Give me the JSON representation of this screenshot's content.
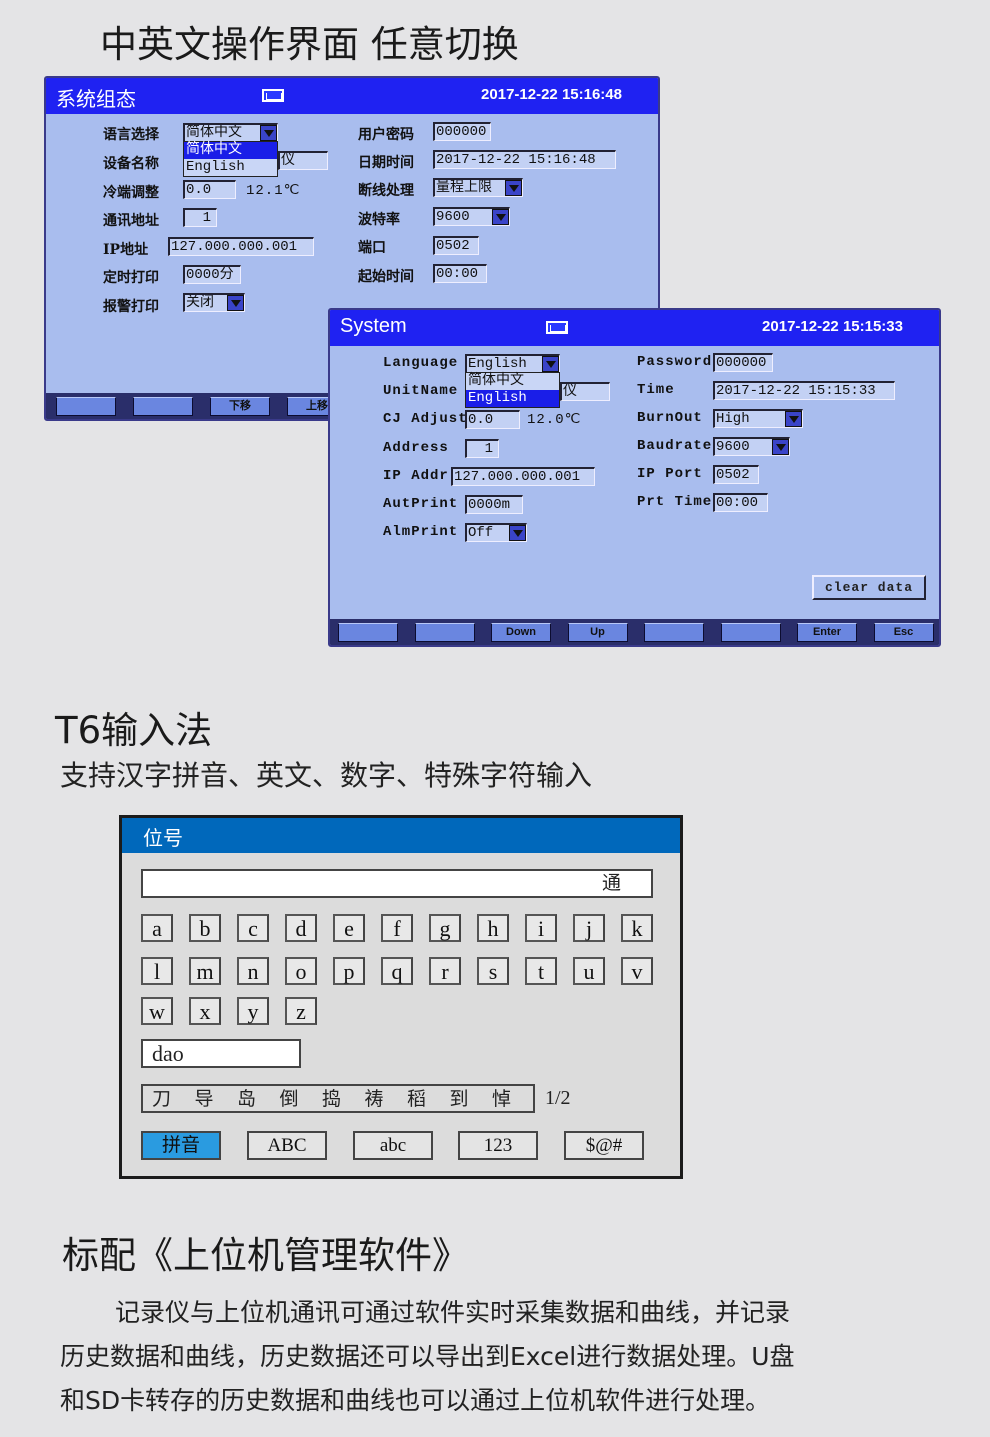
{
  "headline1": "中英文操作界面 任意切换",
  "cn_screen": {
    "title": "系统组态",
    "datetime": "2017-12-22 15:16:48",
    "icon": "keyboard-icon",
    "fields": {
      "language": {
        "label": "语言选择",
        "value": "简体中文",
        "options": [
          "简体中文",
          "English"
        ],
        "selected": 0
      },
      "device_name": {
        "label": "设备名称",
        "value": "仪"
      },
      "cj_adjust": {
        "label": "冷端调整",
        "value": "0.0",
        "reading": "12.1℃"
      },
      "address": {
        "label": "通讯地址",
        "value": "1"
      },
      "ip": {
        "label": "IP地址",
        "value": "127.000.000.001"
      },
      "timed_print": {
        "label": "定时打印",
        "value": "0000分"
      },
      "alarm_print": {
        "label": "报警打印",
        "value": "关闭"
      },
      "password": {
        "label": "用户密码",
        "value": "000000"
      },
      "datetime": {
        "label": "日期时间",
        "value": "2017-12-22 15:16:48"
      },
      "burnout": {
        "label": "断线处理",
        "value": "量程上限"
      },
      "baud": {
        "label": "波特率",
        "value": "9600"
      },
      "port": {
        "label": "端口",
        "value": "0502"
      },
      "start_time": {
        "label": "起始时间",
        "value": "00:00"
      }
    },
    "buttons": [
      "",
      "",
      "下移",
      "上移"
    ]
  },
  "en_screen": {
    "title": "System",
    "datetime": "2017-12-22 15:15:33",
    "icon": "keyboard-icon",
    "fields": {
      "language": {
        "label": "Language",
        "value": "English",
        "options": [
          "简体中文",
          "English"
        ],
        "selected": 1
      },
      "device_name": {
        "label": "UnitName",
        "value": "仪"
      },
      "cj_adjust": {
        "label": "CJ Adjust",
        "value": "0.0",
        "reading": "12.0℃"
      },
      "address": {
        "label": "Address",
        "value": "1"
      },
      "ip": {
        "label": "IP Addr",
        "value": "127.000.000.001"
      },
      "timed_print": {
        "label": "AutPrint",
        "value": "0000m"
      },
      "alarm_print": {
        "label": "AlmPrint",
        "value": "Off"
      },
      "password": {
        "label": "Password",
        "value": "000000"
      },
      "datetime": {
        "label": "Time",
        "value": "2017-12-22 15:15:33"
      },
      "burnout": {
        "label": "BurnOut",
        "value": "High"
      },
      "baud": {
        "label": "Baudrate",
        "value": "9600"
      },
      "port": {
        "label": "IP Port",
        "value": "0502"
      },
      "start_time": {
        "label": "Prt Time",
        "value": "00:00"
      }
    },
    "clear_button": "clear data",
    "buttons": [
      "",
      "",
      "Down",
      "Up",
      "",
      "",
      "Enter",
      "Esc"
    ]
  },
  "headline2": "T6输入法",
  "subtitle2": "支持汉字拼音、英文、数字、特殊字符输入",
  "keypad": {
    "title": "位号",
    "input_value": "通",
    "keys": [
      "a",
      "b",
      "c",
      "d",
      "e",
      "f",
      "g",
      "h",
      "i",
      "j",
      "k",
      "l",
      "m",
      "n",
      "o",
      "p",
      "q",
      "r",
      "s",
      "t",
      "u",
      "v",
      "w",
      "x",
      "y",
      "z"
    ],
    "pinyin": "dao",
    "candidates": [
      "刀",
      "导",
      "岛",
      "倒",
      "捣",
      "祷",
      "稻",
      "到",
      "悼"
    ],
    "page": "1/2",
    "modes": [
      "拼音",
      "ABC",
      "abc",
      "123",
      "$@#"
    ],
    "active_mode": 0,
    "colors": {
      "header": "#0068bb",
      "active": "#2a9be0"
    }
  },
  "headline3": "标配《上位机管理软件》",
  "paragraph": [
    "记录仪与上位机通讯可通过软件实时采集数据和曲线，并记录",
    "历史数据和曲线，历史数据还可以导出到Excel进行数据处理。U盘",
    "和SD卡转存的历史数据和曲线也可以通过上位机软件进行处理。"
  ]
}
